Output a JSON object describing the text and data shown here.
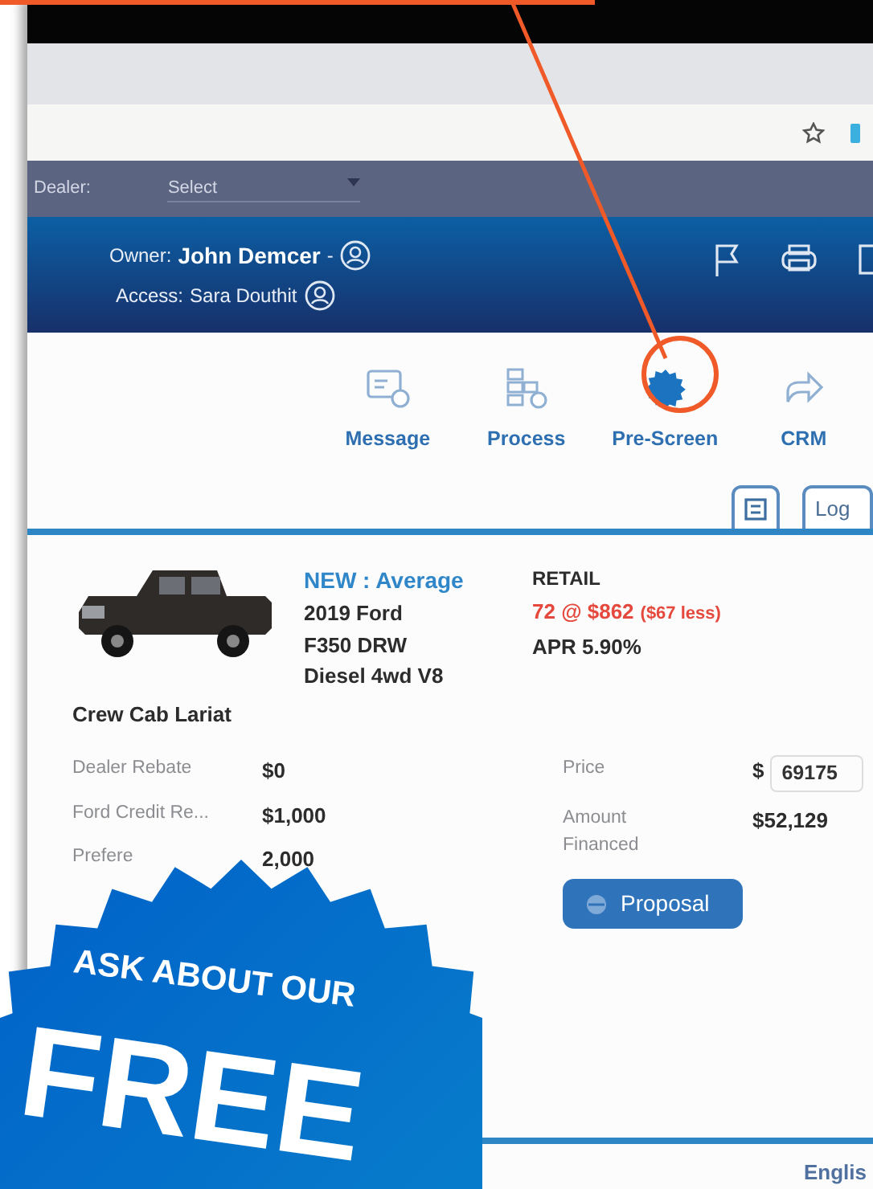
{
  "filter_bar": {
    "label": "Dealer:",
    "select": "Select"
  },
  "header": {
    "owner_label": "Owner:",
    "owner": "John Demcer",
    "owner_caret": "-",
    "access_label": "Access:",
    "access": "Sara Douthit"
  },
  "actions": [
    {
      "label": "Message",
      "kind": "message",
      "highlighted": false
    },
    {
      "label": "Process",
      "kind": "process",
      "highlighted": false
    },
    {
      "label": "Pre-Screen",
      "kind": "prescreen",
      "highlighted": true
    },
    {
      "label": "CRM",
      "kind": "crm",
      "highlighted": false
    }
  ],
  "tabs": [
    {
      "kind": "icon"
    },
    {
      "kind": "text",
      "label": "Log"
    }
  ],
  "vehicle": {
    "condition": "NEW : Average",
    "lines": [
      "2019 Ford",
      "F350 DRW",
      "Diesel 4wd V8"
    ],
    "trim": "Crew Cab Lariat"
  },
  "retail": {
    "title": "RETAIL",
    "payment": "72 @ $862",
    "savings": "($67 less)",
    "apr": "APR 5.90%"
  },
  "rebates": [
    {
      "label": "Dealer Rebate",
      "value": "$0"
    },
    {
      "label": "Ford Credit Re...",
      "value": "$1,000"
    },
    {
      "label": "Prefere",
      "value": "2,000"
    }
  ],
  "price": {
    "label": "Price",
    "currency": "$",
    "value": "69175"
  },
  "financed": {
    "label": "Amount Financed",
    "value": "$52,129"
  },
  "proposal_button": "Proposal",
  "footer": {
    "language": "Englis"
  },
  "promo": {
    "line1": "ASK ABOUT OUR",
    "line2": "FREE"
  }
}
